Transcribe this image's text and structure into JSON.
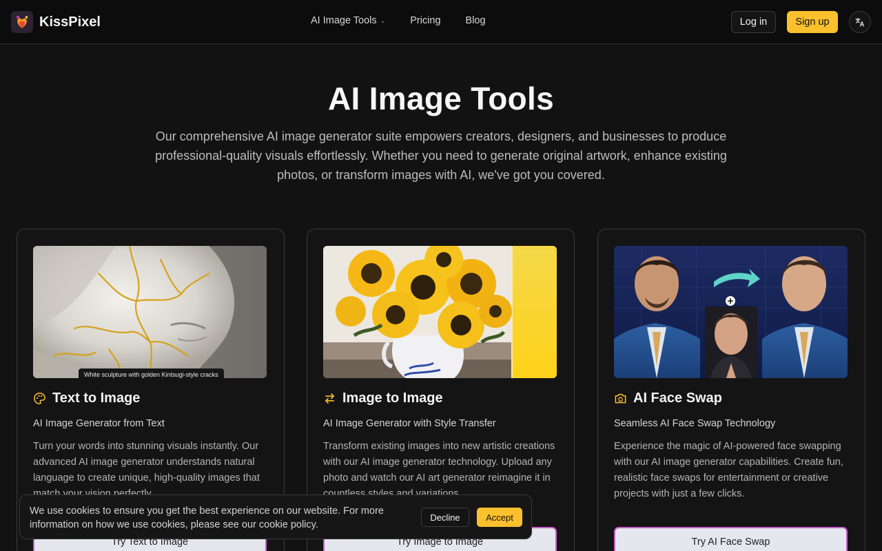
{
  "header": {
    "brand": "KissPixel",
    "nav": [
      {
        "label": "AI Image Tools",
        "dropdown": true
      },
      {
        "label": "Pricing"
      },
      {
        "label": "Blog"
      }
    ],
    "login_label": "Log in",
    "signup_label": "Sign up"
  },
  "hero": {
    "title": "AI Image Tools",
    "description": "Our comprehensive AI image generator suite empowers creators, designers, and businesses to produce professional-quality visuals effortlessly. Whether you need to generate original artwork, enhance existing photos, or transform images with AI, we've got you covered."
  },
  "cards": [
    {
      "title": "Text to Image",
      "subtitle": "AI Image Generator from Text",
      "body": "Turn your words into stunning visuals instantly. Our advanced AI image generator understands natural language to create unique, high-quality images that match your vision perfectly.",
      "image_caption": "White sculpture with golden Kintsugi-style cracks",
      "button": "Try Text to Image",
      "icon": "palette-icon"
    },
    {
      "title": "Image to Image",
      "subtitle": "AI Image Generator with Style Transfer",
      "body": "Transform existing images into new artistic creations with our AI image generator technology. Upload any photo and watch our AI art generator reimagine it in countless styles and variations.",
      "button": "Try Image to Image",
      "icon": "arrows-exchange-icon"
    },
    {
      "title": "AI Face Swap",
      "subtitle": "Seamless AI Face Swap Technology",
      "body": "Experience the magic of AI-powered face swapping with our AI image generator capabilities. Create fun, realistic face swaps for entertainment or creative projects with just a few clicks.",
      "button": "Try AI Face Swap",
      "icon": "camera-swap-icon"
    }
  ],
  "cookie": {
    "text": "We use cookies to ensure you get the best experience on our website. For more information on how we use cookies, please see our cookie policy.",
    "decline": "Decline",
    "accept": "Accept"
  },
  "colors": {
    "accent": "#fbc02d",
    "background": "#121212",
    "card_border": "#3d3d3d"
  }
}
